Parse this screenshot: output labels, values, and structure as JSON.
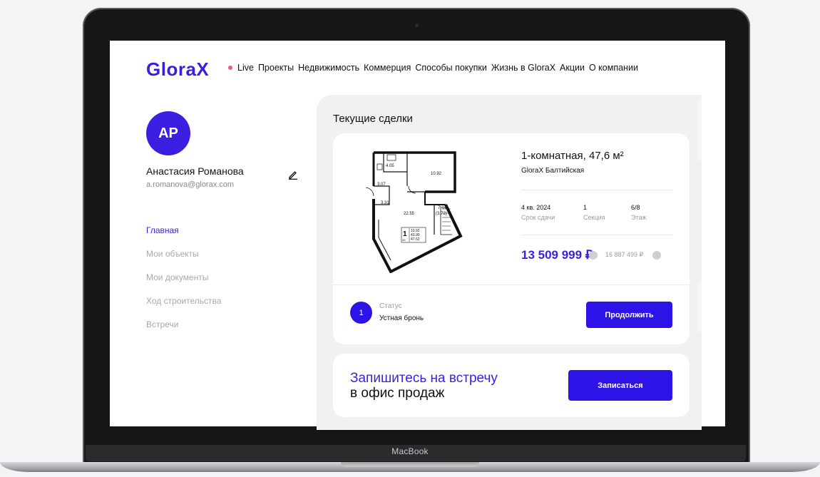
{
  "device": {
    "label": "MacBook"
  },
  "header": {
    "logo": "GloraX",
    "nav": [
      "Live",
      "Проекты",
      "Недвижимость",
      "Коммерция",
      "Способы покупки",
      "Жизнь в GloraX",
      "Акции",
      "О компании"
    ]
  },
  "profile": {
    "initials": "AP",
    "name": "Анастасия Романова",
    "email": "a.romanova@glorax.com"
  },
  "sidebar": {
    "items": [
      "Главная",
      "Мои объекты",
      "Мои документы",
      "Ход строительства",
      "Встречи"
    ],
    "active_index": 0
  },
  "deals": {
    "title": "Текущие сделки",
    "apartment": {
      "title": "1-комнатная, 47,6 м²",
      "complex": "GloraX Балтийская",
      "stats": [
        {
          "value": "4 кв. 2024",
          "label": "Срок сдачи"
        },
        {
          "value": "1",
          "label": "Секция"
        },
        {
          "value": "6/8",
          "label": "Этаж"
        }
      ],
      "price": "13 509 999 ₽",
      "old_price": "16 887 499 ₽",
      "floorplan": {
        "rooms": [
          "4.05",
          "10.92",
          "3.07",
          "3.31",
          "22.55",
          "7.44",
          "(3.72)"
        ],
        "badge": {
          "rooms": "1",
          "number": "49",
          "areas": [
            "10.92",
            "43.90",
            "47.62"
          ]
        }
      }
    },
    "status": {
      "step": "1",
      "label": "Статус",
      "value": "Устная бронь"
    },
    "continue_label": "Продолжить"
  },
  "promo": {
    "line1": "Запишитесь на встречу",
    "line2": "в офис продаж",
    "button_label": "Записаться"
  },
  "colors": {
    "brand": "#3b1fe0",
    "button": "#2e13e8",
    "live_dot": "#f15a6b"
  }
}
